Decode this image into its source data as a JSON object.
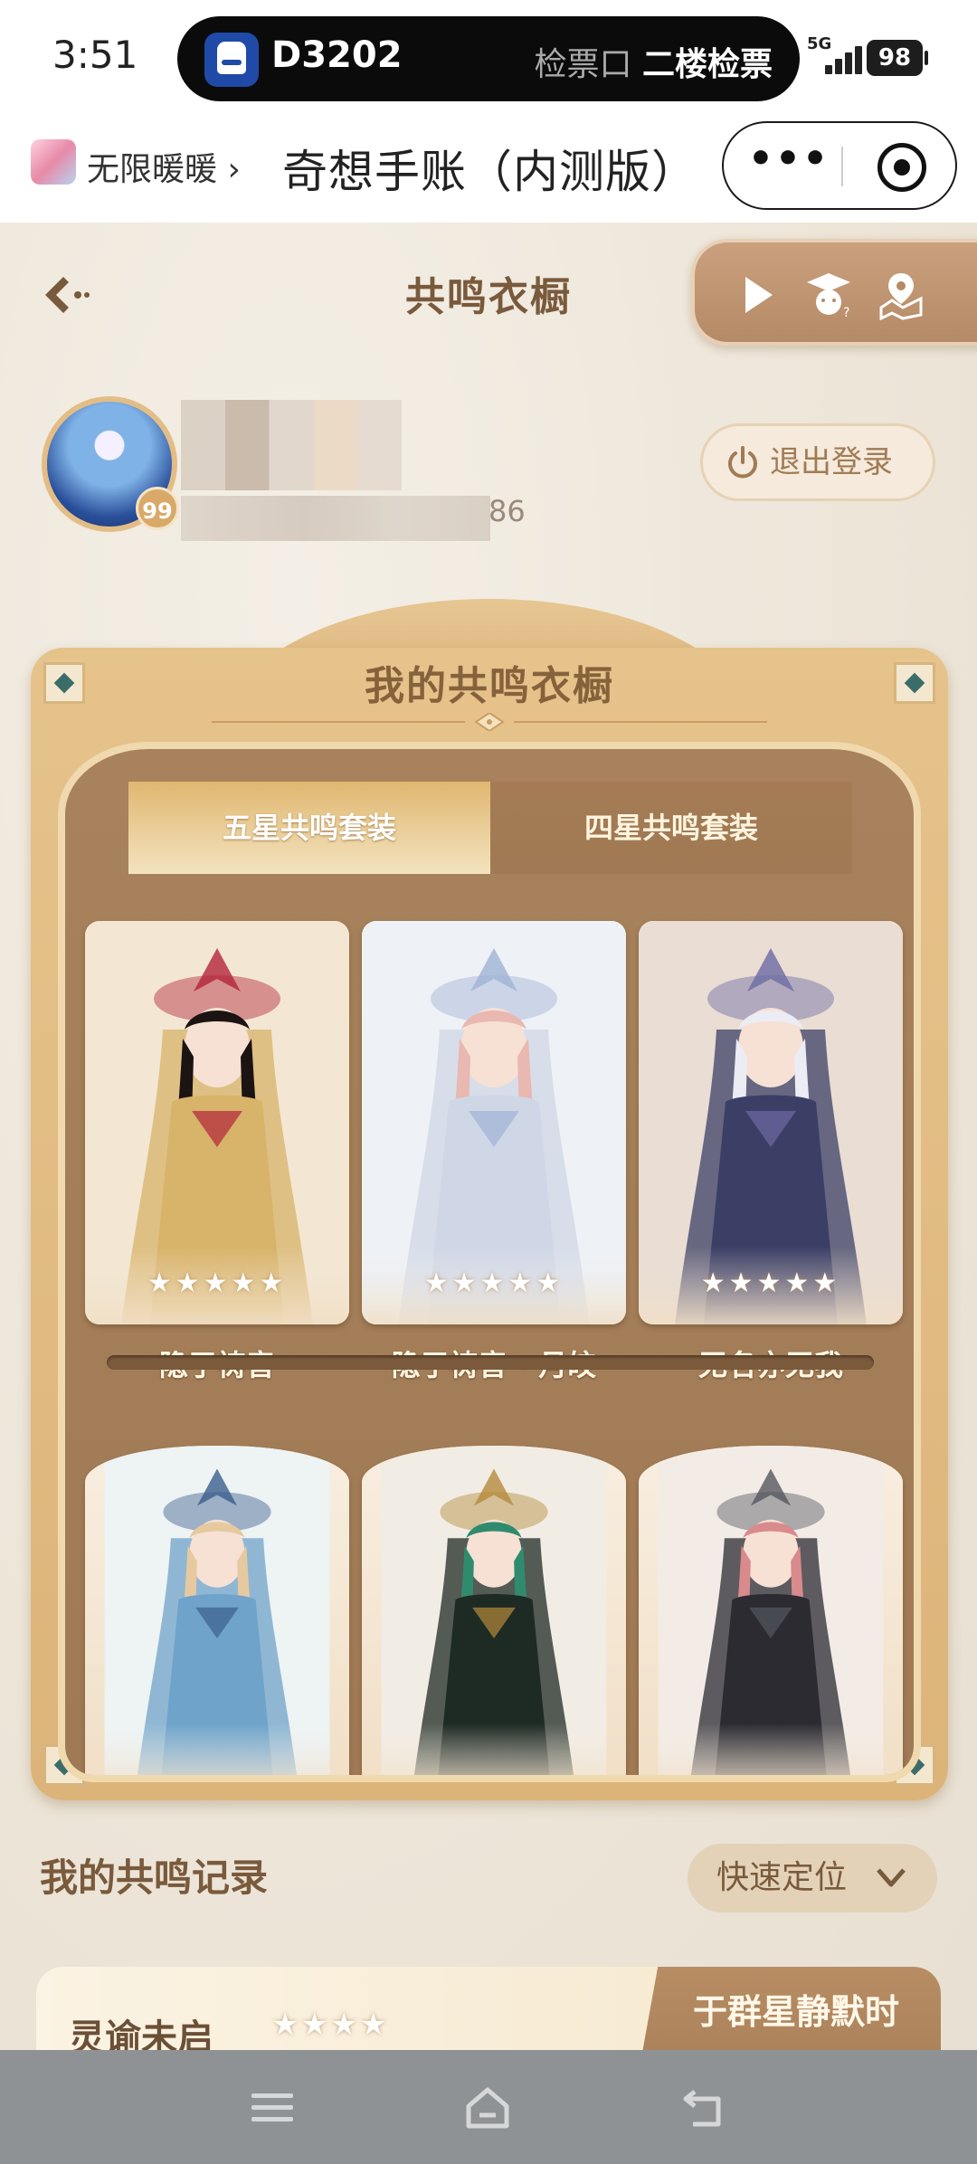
{
  "status_bar": {
    "time": "3:51",
    "trip": {
      "train_no": "D3202",
      "gate_label": "检票口",
      "gate_value": "二楼检票"
    },
    "network": "5G",
    "battery": "98"
  },
  "mini_program_header": {
    "game_name": "无限暖暖",
    "game_chevron": "›",
    "title": "奇想手账（内测版）",
    "more_icon": "more-dots-icon",
    "close_icon": "close-target-icon"
  },
  "page": {
    "title": "共鸣衣橱",
    "tools": [
      "play-arrow-icon",
      "scholar-bear-icon",
      "map-pin-icon"
    ]
  },
  "profile": {
    "level": "99",
    "uid_suffix": "86",
    "logout_label": "退出登录"
  },
  "wardrobe": {
    "title": "我的共鸣衣橱",
    "tabs": [
      {
        "label": "五星共鸣套装",
        "active": true
      },
      {
        "label": "四星共鸣套装",
        "active": false
      }
    ],
    "outfits": [
      {
        "name": "隐于祷音",
        "stars": "★★★★★",
        "palette": [
          "#f3e7d3",
          "#d8b36a",
          "#1c1412",
          "#b3253a"
        ]
      },
      {
        "name": "隐于祷音 · 月皎",
        "stars": "★★★★★",
        "palette": [
          "#eef1f6",
          "#cfd7e6",
          "#e9b8b0",
          "#9fb4d4"
        ]
      },
      {
        "name": "无名亦无我",
        "stars": "★★★★★",
        "palette": [
          "#e9ddd4",
          "#3b3f66",
          "#ececf4",
          "#6d6aa3"
        ]
      },
      {
        "name": "",
        "stars": "",
        "palette": [
          "#eef3f4",
          "#6fa3c9",
          "#e7c9a0",
          "#3b5f8d"
        ]
      },
      {
        "name": "",
        "stars": "",
        "palette": [
          "#f2ede4",
          "#1e2a24",
          "#2f8b6e",
          "#b48a3c"
        ]
      },
      {
        "name": "",
        "stars": "",
        "palette": [
          "#f3ece6",
          "#2b2b31",
          "#d98a8c",
          "#55585f"
        ]
      }
    ]
  },
  "records": {
    "title": "我的共鸣记录",
    "locate_label": "快速定位",
    "first_record": {
      "name": "灵谕未启",
      "stars": "★★★★",
      "right_label": "于群星静默时"
    }
  },
  "nav": [
    "menu-icon",
    "home-icon",
    "back-icon"
  ],
  "colors": {
    "accent": "#7a5a3c",
    "panel": "#dcb47a",
    "board": "#a07a54"
  }
}
